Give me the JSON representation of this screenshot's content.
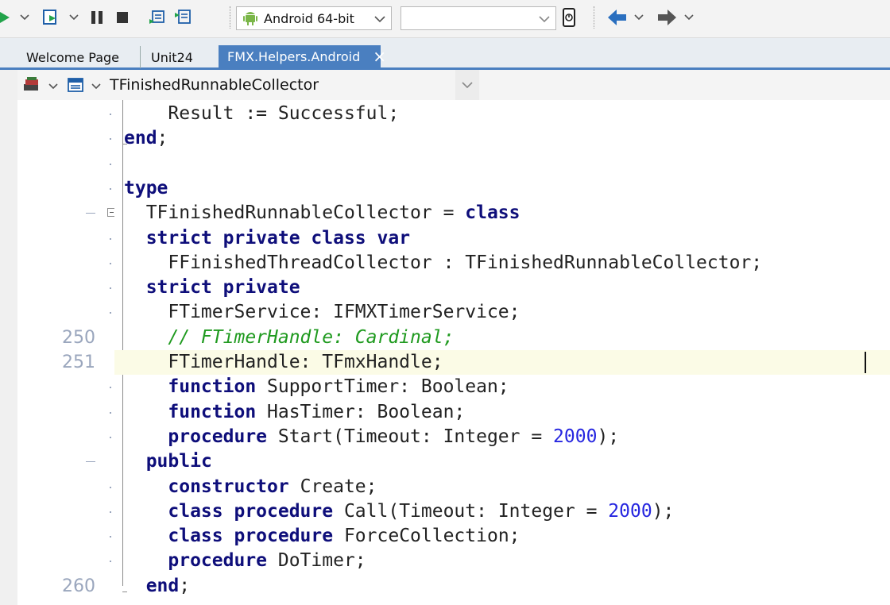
{
  "toolbar": {
    "platform_label": "Android 64-bit",
    "config_value": "",
    "icons": [
      "run-icon",
      "chevron-down-icon",
      "step-over-icon",
      "chevron-down-icon",
      "pause-icon",
      "stop-icon",
      "show-exec-point-icon",
      "run-to-cursor-icon",
      "android-icon",
      "device-icon",
      "back-arrow-icon",
      "chevron-down-icon",
      "forward-arrow-icon",
      "chevron-down-icon"
    ]
  },
  "tabs": [
    {
      "label": "Welcome Page",
      "active": false
    },
    {
      "label": "Unit24",
      "active": false
    },
    {
      "label": "FMX.Helpers.Android",
      "active": true,
      "close": "×"
    }
  ],
  "navbar": {
    "symbol": "TFinishedRunnableCollector"
  },
  "colors": {
    "keyword": "#0e0e7a",
    "number": "#2626e0",
    "comment": "#1f9a1f",
    "accent": "#4a7fc0",
    "current_line": "#fbfbe6"
  },
  "code": {
    "lines": [
      {
        "gutter": "",
        "segments": [
          {
            "t": "    Result := Successful;",
            "c": "plain"
          }
        ]
      },
      {
        "gutter": "",
        "segments": [
          {
            "t": "end",
            "c": "kw"
          },
          {
            "t": ";",
            "c": "plain"
          }
        ]
      },
      {
        "gutter": "",
        "segments": []
      },
      {
        "gutter": "",
        "segments": [
          {
            "t": "type",
            "c": "kw"
          }
        ]
      },
      {
        "gutter": "",
        "segments": [
          {
            "t": "  TFinishedRunnableCollector = ",
            "c": "plain"
          },
          {
            "t": "class",
            "c": "kw"
          }
        ]
      },
      {
        "gutter": "",
        "segments": [
          {
            "t": "  ",
            "c": "plain"
          },
          {
            "t": "strict private class var",
            "c": "kw"
          }
        ]
      },
      {
        "gutter": "",
        "segments": [
          {
            "t": "    FFinishedThreadCollector : TFinishedRunnableCollector;",
            "c": "plain"
          }
        ]
      },
      {
        "gutter": "",
        "segments": [
          {
            "t": "  ",
            "c": "plain"
          },
          {
            "t": "strict private",
            "c": "kw"
          }
        ]
      },
      {
        "gutter": "",
        "segments": [
          {
            "t": "    FTimerService: IFMXTimerService;",
            "c": "plain"
          }
        ]
      },
      {
        "gutter": "250",
        "segments": [
          {
            "t": "    ",
            "c": "plain"
          },
          {
            "t": "// FTimerHandle: Cardinal;",
            "c": "cmt"
          }
        ]
      },
      {
        "gutter": "251",
        "segments": [
          {
            "t": "    FTimerHandle: TFmxHandle;",
            "c": "plain"
          }
        ]
      },
      {
        "gutter": "",
        "segments": [
          {
            "t": "    ",
            "c": "plain"
          },
          {
            "t": "function",
            "c": "kw"
          },
          {
            "t": " SupportTimer: Boolean;",
            "c": "plain"
          }
        ]
      },
      {
        "gutter": "",
        "segments": [
          {
            "t": "    ",
            "c": "plain"
          },
          {
            "t": "function",
            "c": "kw"
          },
          {
            "t": " HasTimer: Boolean;",
            "c": "plain"
          }
        ]
      },
      {
        "gutter": "",
        "segments": [
          {
            "t": "    ",
            "c": "plain"
          },
          {
            "t": "procedure",
            "c": "kw"
          },
          {
            "t": " Start(Timeout: Integer = ",
            "c": "plain"
          },
          {
            "t": "2000",
            "c": "num"
          },
          {
            "t": ");",
            "c": "plain"
          }
        ]
      },
      {
        "gutter": "",
        "segments": [
          {
            "t": "  ",
            "c": "plain"
          },
          {
            "t": "public",
            "c": "kw"
          }
        ]
      },
      {
        "gutter": "",
        "segments": [
          {
            "t": "    ",
            "c": "plain"
          },
          {
            "t": "constructor",
            "c": "kw"
          },
          {
            "t": " Create;",
            "c": "plain"
          }
        ]
      },
      {
        "gutter": "",
        "segments": [
          {
            "t": "    ",
            "c": "plain"
          },
          {
            "t": "class procedure",
            "c": "kw"
          },
          {
            "t": " Call(Timeout: Integer = ",
            "c": "plain"
          },
          {
            "t": "2000",
            "c": "num"
          },
          {
            "t": ");",
            "c": "plain"
          }
        ]
      },
      {
        "gutter": "",
        "segments": [
          {
            "t": "    ",
            "c": "plain"
          },
          {
            "t": "class procedure",
            "c": "kw"
          },
          {
            "t": " ForceCollection;",
            "c": "plain"
          }
        ]
      },
      {
        "gutter": "",
        "segments": [
          {
            "t": "    ",
            "c": "plain"
          },
          {
            "t": "procedure",
            "c": "kw"
          },
          {
            "t": " DoTimer;",
            "c": "plain"
          }
        ]
      },
      {
        "gutter": "260",
        "segments": [
          {
            "t": "  ",
            "c": "plain"
          },
          {
            "t": "end",
            "c": "kw"
          },
          {
            "t": ";",
            "c": "plain"
          }
        ]
      }
    ]
  }
}
